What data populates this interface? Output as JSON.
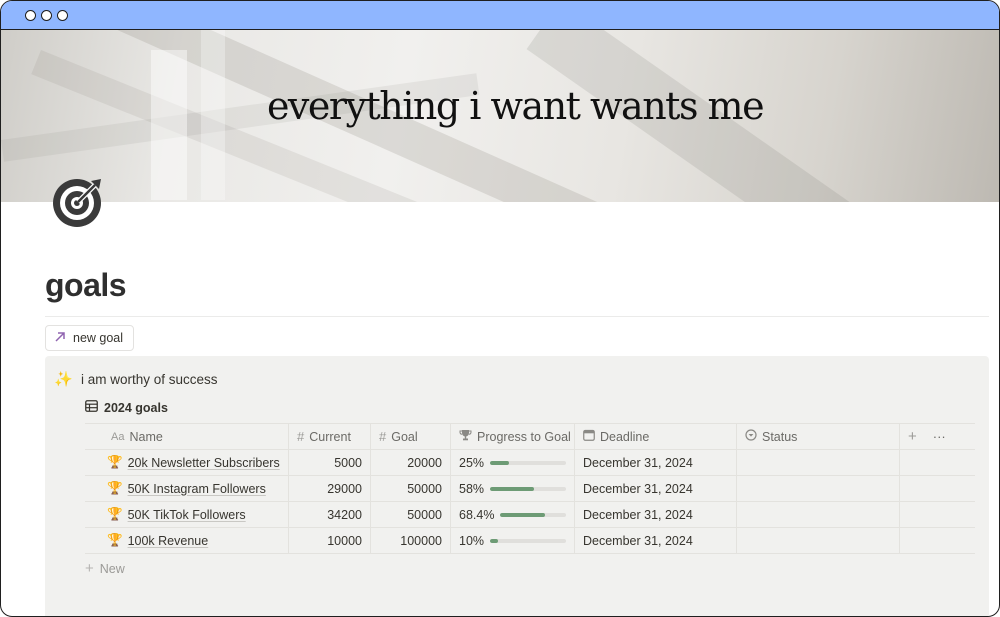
{
  "cover": {
    "text": "everything i want wants me"
  },
  "page": {
    "title": "goals",
    "icon": "target-icon"
  },
  "new_goal_button": {
    "label": "new goal",
    "icon": "arrow-up-right-icon",
    "icon_color": "#9065b0"
  },
  "callout": {
    "icon": "sparkles-icon",
    "emoji": "✨",
    "text": "i am worthy of success"
  },
  "database": {
    "title": "2024 goals",
    "icon": "table-icon",
    "columns": [
      {
        "label": "Name",
        "icon": "text-aa-icon"
      },
      {
        "label": "Current",
        "icon": "hash-icon"
      },
      {
        "label": "Goal",
        "icon": "hash-icon"
      },
      {
        "label": "Progress to Goal",
        "icon": "trophy-icon"
      },
      {
        "label": "Deadline",
        "icon": "calendar-icon"
      },
      {
        "label": "Status",
        "icon": "status-icon"
      }
    ],
    "rows": [
      {
        "emoji": "🏆",
        "name": "20k Newsletter Subscribers",
        "current": "5000",
        "goal": "20000",
        "progress_label": "25%",
        "progress": 0.25,
        "deadline": "December 31, 2024",
        "status": ""
      },
      {
        "emoji": "🏆",
        "name": "50K Instagram Followers",
        "current": "29000",
        "goal": "50000",
        "progress_label": "58%",
        "progress": 0.58,
        "deadline": "December 31, 2024",
        "status": ""
      },
      {
        "emoji": "🏆",
        "name": "50K TikTok Followers",
        "current": "34200",
        "goal": "50000",
        "progress_label": "68.4%",
        "progress": 0.684,
        "deadline": "December 31, 2024",
        "status": ""
      },
      {
        "emoji": "🏆",
        "name": "100k Revenue",
        "current": "10000",
        "goal": "100000",
        "progress_label": "10%",
        "progress": 0.1,
        "deadline": "December 31, 2024",
        "status": ""
      }
    ],
    "add_column": "+",
    "more": "···",
    "new_label": "New"
  },
  "colors": {
    "titlebar": "#8fb6ff",
    "callout_bg": "#f1f1ef",
    "progress_fill": "#6d9b75"
  }
}
